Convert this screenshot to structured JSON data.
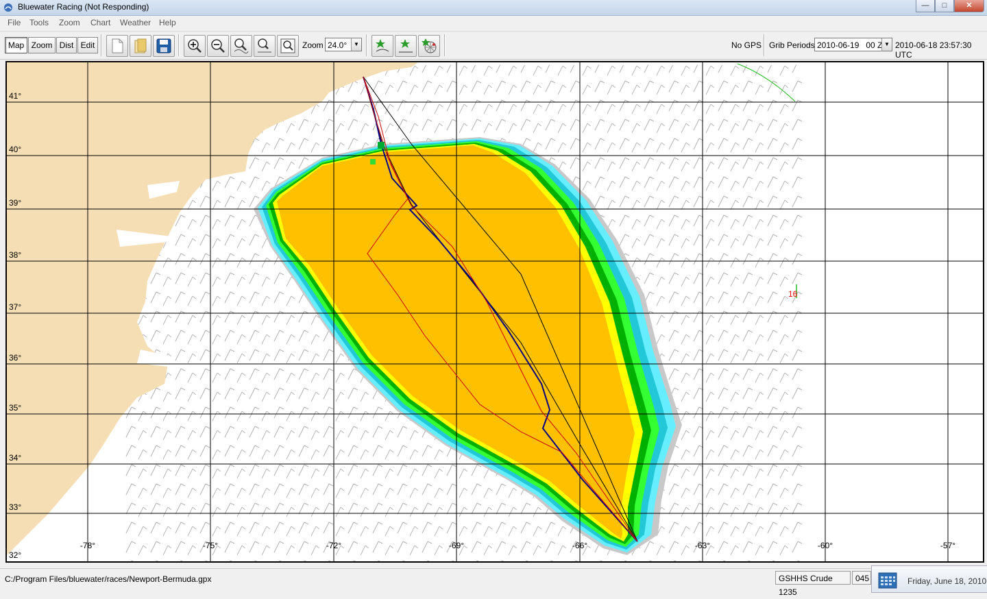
{
  "window": {
    "title": "Bluewater Racing (Not Responding)",
    "buttons": {
      "minimize": "—",
      "maximize": "□",
      "close": "✕"
    }
  },
  "menu": [
    "File",
    "Tools",
    "Zoom",
    "Chart",
    "Weather",
    "Help"
  ],
  "toolbar": {
    "modes": [
      "Map",
      "Zoom",
      "Dist",
      "Edit"
    ],
    "active_mode": "Map",
    "zoom_label": "Zoom",
    "zoom_value": "24.0°",
    "gps_status": "No GPS",
    "grib_label": "Grib Periods",
    "grib_value": "2010-06-19   00 Z",
    "utc_time": "2010-06-18 23:57:30 UTC",
    "icons": [
      "new-file-icon",
      "open-folder-icon",
      "save-disk-icon",
      "zoom-in-icon",
      "zoom-out-icon",
      "zoom-area-icon",
      "zoom-track-icon",
      "zoom-fit-icon",
      "route-start-icon",
      "route-mark-icon",
      "polar-wheel-icon"
    ]
  },
  "map": {
    "lat_labels": [
      "41°",
      "40°",
      "39°",
      "38°",
      "37°",
      "36°",
      "35°",
      "34°",
      "33°",
      "32°"
    ],
    "lon_labels": [
      "-78°",
      "-75°",
      "-72°",
      "-69°",
      "-66°",
      "-63°",
      "-60°",
      "-57°"
    ],
    "marker_label": "16",
    "colors": {
      "land": "#f5deb3",
      "isochrone_core": "#ffc000",
      "isochrone_yellow": "#ffff00",
      "isochrone_green": "#00c000",
      "isochrone_lightgreen": "#33ff33",
      "isochrone_cyan": "#33ccdd",
      "isochrone_lightcyan": "#66eeff",
      "isochrone_gray": "#c8c8c8",
      "route_blue": "#000080",
      "route_red": "#cc0000",
      "wind_barb": "#a0a0a0"
    }
  },
  "status": {
    "file_path": "C:/Program Files/bluewater/races/Newport-Bermuda.gpx",
    "chart_db": "GSHHS Crude 1235",
    "heading": "045",
    "date": "Friday, June 18, 2010"
  }
}
